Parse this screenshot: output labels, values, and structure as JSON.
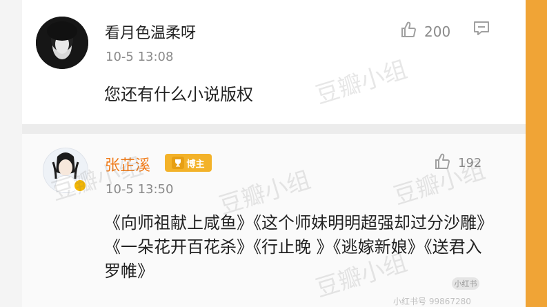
{
  "comments": [
    {
      "username": "看月色温柔呀",
      "time": "10-5 13:08",
      "likes": "200",
      "content": "您还有什么小说版权"
    },
    {
      "username": "张芷溪",
      "badge": "博主",
      "time": "10-5 13:50",
      "likes": "192",
      "content": "《向师祖献上咸鱼》《这个师妹明明超强却过分沙雕》《一朵花开百花杀》《行止晚 》《逃嫁新娘》《送君入罗帷》"
    }
  ],
  "watermarks": [
    "豆瓣小组",
    "豆瓣小组",
    "豆瓣小组",
    "豆瓣小组",
    "豆瓣小组"
  ],
  "overlay": {
    "badge": "小红书",
    "footer": "小红书号 99867280"
  },
  "icons": {
    "like": "thumb-up-icon",
    "comment": "comment-icon",
    "badge": "trophy-icon"
  },
  "colors": {
    "accent": "#f07a18",
    "badge": "#f3b229",
    "right_band": "#f0a436"
  }
}
